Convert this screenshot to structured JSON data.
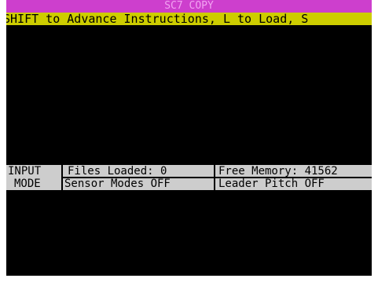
{
  "app": {
    "title": "SC7 COPY"
  },
  "scroller": {
    "text": "SHIFT to Advance Instructions, L to Load, S"
  },
  "status": {
    "mode_line1": "INPUT",
    "mode_line2": "MODE",
    "files_loaded": "Files Loaded: 0",
    "free_memory": "Free Memory: 41562",
    "sensor_modes": "Sensor Modes OFF",
    "leader_pitch": "Leader Pitch OFF"
  },
  "colors": {
    "border": "#ffffff",
    "screen": "#000000",
    "title_bar": "#cd3fcd",
    "title_text": "#f2a3f2",
    "scroller_bg": "#cdcd00",
    "status_bg": "#cdcdcd"
  }
}
